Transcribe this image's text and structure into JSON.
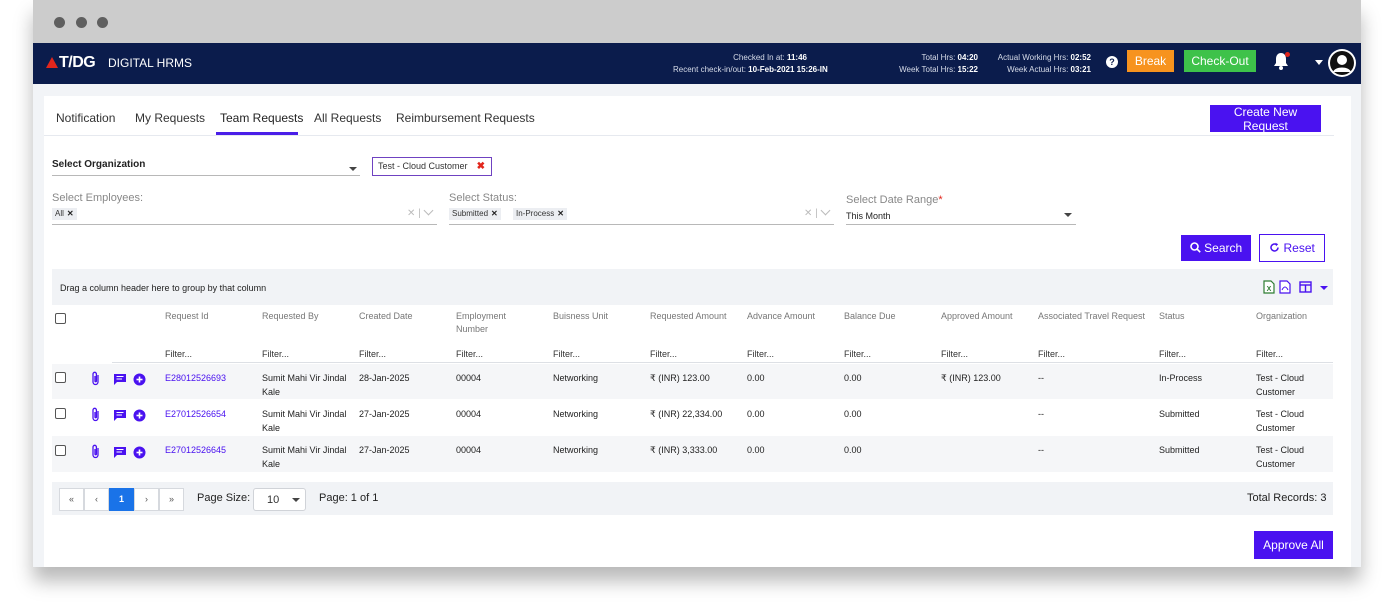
{
  "app": {
    "logo": "T/DG",
    "name": "DIGITAL HRMS",
    "checked_in_label": "Checked In at:",
    "checked_in_value": "11:46",
    "recent_label": "Recent check-in/out:",
    "recent_value": "10-Feb-2021 15:26-IN",
    "total_hrs_label": "Total Hrs:",
    "total_hrs_value": "04:20",
    "week_total_label": "Week Total Hrs:",
    "week_total_value": "15:22",
    "actual_label": "Actual Working Hrs:",
    "actual_value": "02:52",
    "week_actual_label": "Week Actual Hrs:",
    "week_actual_value": "03:21",
    "help": "?",
    "break_label": "Break",
    "checkout_label": "Check-Out"
  },
  "tabs": [
    "Notification",
    "My Requests",
    "Team Requests",
    "All Requests",
    "Reimbursement Requests"
  ],
  "active_tab": "Team Requests",
  "create_label": "Create New Request",
  "filters": {
    "org_label": "Select Organization",
    "org_chip": "Test - Cloud Customer",
    "employees_label": "Select Employees:",
    "employees_chips": [
      "All"
    ],
    "status_label": "Select Status:",
    "status_chips": [
      "Submitted",
      "In-Process"
    ],
    "date_label": "Select Date Range",
    "date_required": "*",
    "date_value": "This Month",
    "search_label": "Search",
    "reset_label": "Reset"
  },
  "grid": {
    "group_hint": "Drag a column header here to group by that column",
    "columns": [
      "Request Id",
      "Requested By",
      "Created Date",
      "Employment Number",
      "Buisness Unit",
      "Requested Amount",
      "Advance Amount",
      "Balance Due",
      "Approved Amount",
      "Associated Travel Request",
      "Status",
      "Organization"
    ],
    "filter_placeholder": "Filter...",
    "rows": [
      {
        "id": "E28012526693",
        "by": "Sumit Mahi Vir Jindal Kale",
        "created": "28-Jan-2025",
        "emp_no": "00004",
        "unit": "Networking",
        "requested": "₹ (INR) 123.00",
        "advance": "0.00",
        "balance": "0.00",
        "approved": "₹ (INR) 123.00",
        "travel": "--",
        "status": "In-Process",
        "org": "Test - Cloud Customer"
      },
      {
        "id": "E27012526654",
        "by": "Sumit Mahi Vir Jindal Kale",
        "created": "27-Jan-2025",
        "emp_no": "00004",
        "unit": "Networking",
        "requested": "₹ (INR) 22,334.00",
        "advance": "0.00",
        "balance": "0.00",
        "approved": "",
        "travel": "--",
        "status": "Submitted",
        "org": "Test - Cloud Customer"
      },
      {
        "id": "E27012526645",
        "by": "Sumit Mahi Vir Jindal Kale",
        "created": "27-Jan-2025",
        "emp_no": "00004",
        "unit": "Networking",
        "requested": "₹ (INR) 3,333.00",
        "advance": "0.00",
        "balance": "0.00",
        "approved": "",
        "travel": "--",
        "status": "Submitted",
        "org": "Test - Cloud Customer"
      }
    ]
  },
  "pager": {
    "first": "«",
    "prev": "‹",
    "current": "1",
    "next": "›",
    "last": "»",
    "size_label": "Page Size:",
    "size_value": "10",
    "page_info": "Page: 1 of 1",
    "total": "Total Records: 3"
  },
  "approve_all_label": "Approve All",
  "colors": {
    "nav": "#0b1c4c",
    "primary": "#4a12f0",
    "break": "#f7931e",
    "checkout": "#3ec24a",
    "active_page": "#1a73e8"
  }
}
